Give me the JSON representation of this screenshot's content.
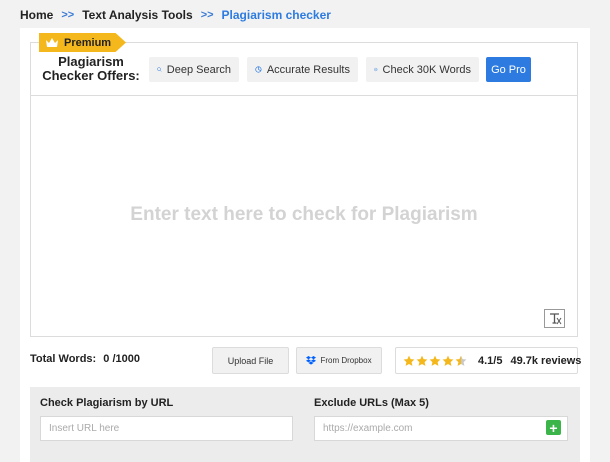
{
  "breadcrumb": {
    "items": [
      "Home",
      "Text Analysis Tools",
      "Plagiarism checker"
    ],
    "separator": ">>"
  },
  "offers": {
    "badge": "Premium",
    "title": "Plagiarism Checker Offers:",
    "features": [
      {
        "label": "Deep Search",
        "icon": "search-icon"
      },
      {
        "label": "Accurate Results",
        "icon": "pie-chart-icon"
      },
      {
        "label": "Check 30K Words",
        "icon": "check-circle-icon"
      }
    ],
    "go_pro": "Go Pro"
  },
  "editor": {
    "placeholder": "Enter text here to check for Plagiarism"
  },
  "stats": {
    "total_words_label": "Total Words:",
    "total_words_value": "0 /1000",
    "upload_label": "Upload File",
    "dropbox_label": "From Dropbox"
  },
  "rating": {
    "stars": 4.1,
    "max": 5,
    "value_text": "4.1/5",
    "reviews": "49.7k reviews"
  },
  "url_check": {
    "check_label": "Check Plagiarism by URL",
    "check_placeholder": "Insert URL here",
    "exclude_label": "Exclude URLs (Max 5)",
    "exclude_placeholder": "https://example.com"
  },
  "colors": {
    "accent": "#2d7be0",
    "premium": "#f5b81c",
    "star": "#f5b81c",
    "add": "#3bb54a"
  }
}
